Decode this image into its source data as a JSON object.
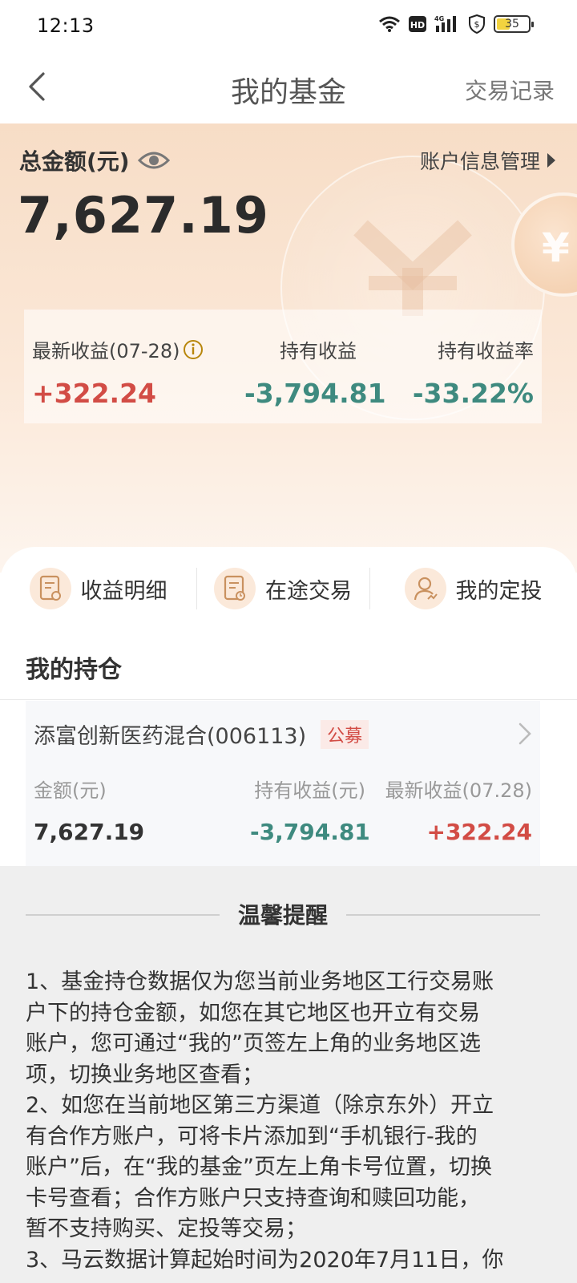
{
  "status_bar": {
    "time": "12:13",
    "battery": "35",
    "icons": [
      "wifi-icon",
      "hd-icon",
      "4g-signal-icon",
      "shield-icon",
      "battery-icon"
    ]
  },
  "nav": {
    "title": "我的基金",
    "right_link": "交易记录",
    "back_icon": "chevron-left-icon"
  },
  "summary": {
    "total_label": "总金额(元)",
    "total_value": "7,627.19",
    "account_link": "账户信息管理",
    "stats": [
      {
        "label": "最新收益(07-28)",
        "value": "+322.24",
        "trend": "up"
      },
      {
        "label": "持有收益",
        "value": "-3,794.81",
        "trend": "down"
      },
      {
        "label": "持有收益率",
        "value": "-33.22%",
        "trend": "down"
      }
    ]
  },
  "functions": [
    {
      "label": "收益明细",
      "icon": "income-detail-icon"
    },
    {
      "label": "在途交易",
      "icon": "pending-trade-icon"
    },
    {
      "label": "我的定投",
      "icon": "auto-invest-icon"
    }
  ],
  "holdings": {
    "title": "我的持仓",
    "fund": {
      "name": "添富创新医药混合(006113)",
      "tag": "公募",
      "amount_label": "金额(元)",
      "amount": "7,627.19",
      "holding_income_label": "持有收益(元)",
      "holding_income": "-3,794.81",
      "latest_income_label": "最新收益(07.28)",
      "latest_income": "+322.24"
    }
  },
  "reminder": {
    "title": "温馨提醒",
    "lines": [
      "1、基金持仓数据仅为您当前业务地区工行交易账",
      "户下的持仓金额，如您在其它地区也开立有交易",
      "账户，您可通过“我的”页签左上角的业务地区选",
      "项，切换业务地区查看；",
      "2、如您在当前地区第三方渠道（除京东外）开立",
      "有合作方账户，可将卡片添加到“手机银行-我的",
      "账户”后，在“我的基金”页左上角卡号位置，切换",
      "卡号查看；合作方账户只支持查询和赎回功能，",
      "暂不支持购买、定投等交易；",
      "3、马云数据计算起始时间为2020年7月11日，你"
    ]
  },
  "colors": {
    "up": "#d24c45",
    "down": "#3e8a7f",
    "header_bg": "#f7ddc6"
  }
}
